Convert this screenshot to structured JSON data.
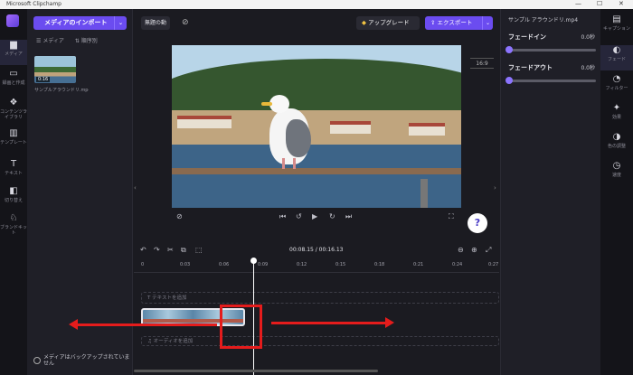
{
  "app": {
    "title": "Microsoft Clipchamp",
    "window_controls": {
      "minimize": "—",
      "maximize": "☐",
      "close": "✕"
    }
  },
  "left_rail": {
    "items": [
      {
        "icon": "▆",
        "label": "メディア",
        "active": true
      },
      {
        "icon": "▭",
        "label": "録画と作成"
      },
      {
        "icon": "❖",
        "label": "コンテンツライブラリ"
      },
      {
        "icon": "▥",
        "label": "テンプレート"
      },
      {
        "icon": "T",
        "label": "テキスト"
      },
      {
        "icon": "◧",
        "label": "切り替え"
      },
      {
        "icon": "♘",
        "label": "ブランドキット"
      }
    ]
  },
  "media": {
    "import_label": "メディアのインポート",
    "dropdown": "⌄",
    "sort_label": "メディア",
    "sort2": "順序別",
    "thumb_duration": "0:16",
    "thumb_label": "サンプルアラウンドリ.mp4",
    "backup_text": "メディアはバックアップされていません"
  },
  "topbar": {
    "project_name": "無題の動",
    "upgrade_label": "アップグレード",
    "upgrade_icon": "◆",
    "export_label": "エクスポート",
    "export_icon": "⇪"
  },
  "preview": {
    "ratio": "16:9",
    "controls": [
      "⊘",
      "⏮",
      "↺",
      "▶",
      "↻",
      "⏭",
      "⛶"
    ],
    "help": "?"
  },
  "timeline": {
    "toolbar_left": [
      "↶",
      "↷",
      "✂",
      "⧉",
      "⬚"
    ],
    "timecode": "00:08.15 / 00:16.13",
    "toolbar_right": [
      "⊖",
      "⊕",
      "⤢"
    ],
    "ticks": [
      "0",
      "0:03",
      "0:06",
      "0:09",
      "0:12",
      "0:15",
      "0:18",
      "0:21",
      "0:24",
      "0:27"
    ],
    "text_track": "T テキストを追加",
    "audio_track": "♫ オーディオを追加"
  },
  "properties": {
    "filename": "サンプル アラウンドリ.mp4",
    "fade_in_label": "フェードイン",
    "fade_in_value": "0.0秒",
    "fade_out_label": "フェードアウト",
    "fade_out_value": "0.0秒"
  },
  "right_rail": {
    "items": [
      {
        "icon": "▤",
        "label": "キャプション"
      },
      {
        "icon": "◐",
        "label": "フェード",
        "active": true
      },
      {
        "icon": "◔",
        "label": "フィルター"
      },
      {
        "icon": "✦",
        "label": "効果"
      },
      {
        "icon": "◑",
        "label": "色の調整"
      },
      {
        "icon": "◷",
        "label": "速度"
      }
    ]
  }
}
